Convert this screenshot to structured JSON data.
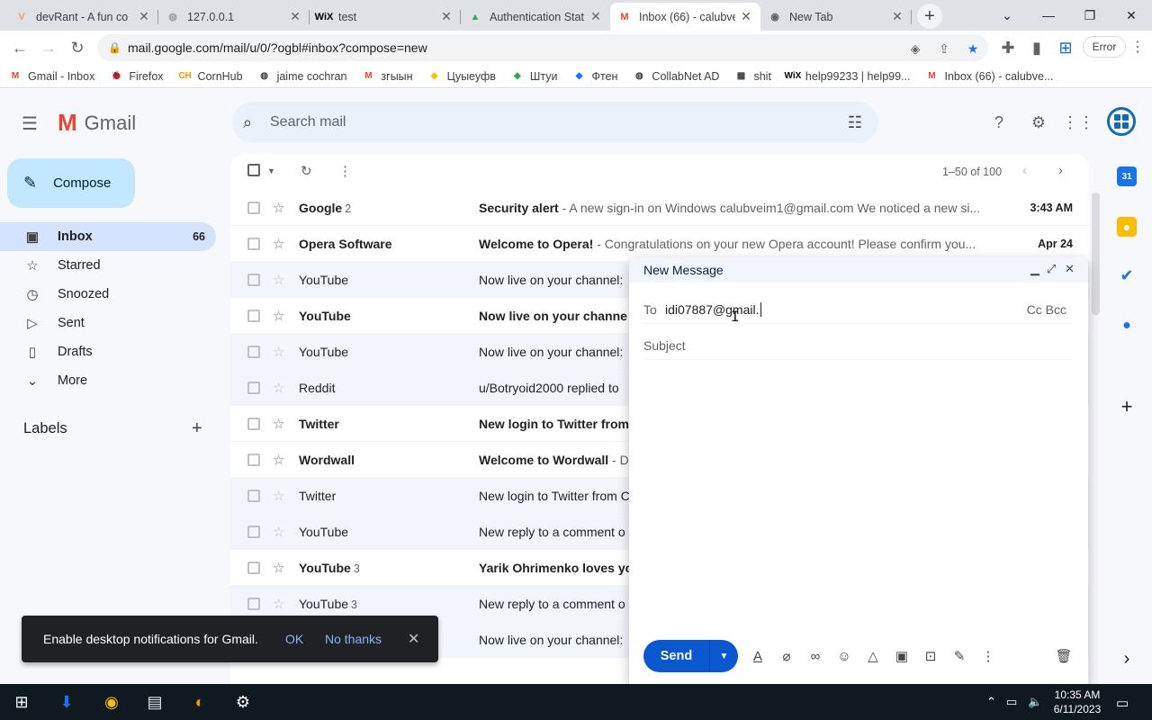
{
  "browser": {
    "tabs": [
      {
        "title": "devRant - A fun co",
        "favicon": "devrant-icon",
        "fav_text": "V",
        "fav_color": "#f99a66"
      },
      {
        "title": "127.0.0.1",
        "favicon": "globe-icon",
        "fav_text": "◍",
        "fav_color": "#9aa0a6"
      },
      {
        "title": "test",
        "favicon": "wix-icon",
        "fav_text": "WiX",
        "fav_color": "#000000"
      },
      {
        "title": "Authentication Stat",
        "favicon": "google-drive-icon",
        "fav_text": "▲",
        "fav_color": "#34a853"
      },
      {
        "title": "Inbox (66) - calubve",
        "favicon": "gmail-icon",
        "fav_text": "M",
        "fav_color": "#ea4335"
      },
      {
        "title": "New Tab",
        "favicon": "chrome-icon",
        "fav_text": "◉",
        "fav_color": "#5f6368"
      }
    ],
    "url": "mail.google.com/mail/u/0/?ogbl#inbox?compose=new",
    "error_label": "Error",
    "bookmarks": [
      {
        "label": "Gmail - Inbox",
        "icon": "gmail-icon",
        "glyph": "M",
        "color": "#ea4335"
      },
      {
        "label": "Firefox",
        "icon": "firefox-icon",
        "glyph": "🐞",
        "color": "#b3261e"
      },
      {
        "label": "CornHub",
        "icon": "cornhub-icon",
        "glyph": "CH",
        "color": "#f29900"
      },
      {
        "label": "jaime cochran",
        "icon": "globe-icon",
        "glyph": "◍",
        "color": "#3c4043"
      },
      {
        "label": "згыын",
        "icon": "gmail-icon",
        "glyph": "M",
        "color": "#ea4335"
      },
      {
        "label": "Цуыеуфв",
        "icon": "maps-pin-icon",
        "glyph": "◆",
        "color": "#fbbc04"
      },
      {
        "label": "Штуи",
        "icon": "maps-pin-icon",
        "glyph": "◆",
        "color": "#34a853"
      },
      {
        "label": "Фтен",
        "icon": "flutter-icon",
        "glyph": "◆",
        "color": "#1a73e8"
      },
      {
        "label": "CollabNet AD",
        "icon": "globe-icon",
        "glyph": "◍",
        "color": "#3c4043"
      },
      {
        "label": "shit",
        "icon": "archive-icon",
        "glyph": "▦",
        "color": "#3c4043"
      },
      {
        "label": "help99233 | help99...",
        "icon": "wix-icon",
        "glyph": "WiX",
        "color": "#000000"
      },
      {
        "label": "Inbox (66) - calubve...",
        "icon": "gmail-icon",
        "glyph": "M",
        "color": "#ea4335"
      }
    ]
  },
  "gmail": {
    "brand": "Gmail",
    "search_placeholder": "Search mail",
    "compose_label": "Compose",
    "nav": [
      {
        "label": "Inbox",
        "count": "66",
        "icon": "inbox-icon",
        "glyph": "▣"
      },
      {
        "label": "Starred",
        "count": "",
        "icon": "star-icon",
        "glyph": "☆"
      },
      {
        "label": "Snoozed",
        "count": "",
        "icon": "clock-icon",
        "glyph": "◷"
      },
      {
        "label": "Sent",
        "count": "",
        "icon": "send-icon",
        "glyph": "▷"
      },
      {
        "label": "Drafts",
        "count": "",
        "icon": "draft-icon",
        "glyph": "▯"
      },
      {
        "label": "More",
        "count": "",
        "icon": "chevron-down-icon",
        "glyph": "⌄"
      }
    ],
    "labels_heading": "Labels",
    "pagination": "1–50 of 100",
    "emails": [
      {
        "sender": "Google",
        "count": "2",
        "subject": "Security alert",
        "snippet": " - A new sign-in on Windows calubveim1@gmail.com We noticed a new si...",
        "date": "3:43 AM",
        "unread": true
      },
      {
        "sender": "Opera Software",
        "count": "",
        "subject": "Welcome to Opera!",
        "snippet": " - Congratulations on your new Opera account! Please confirm you...",
        "date": "Apr 24",
        "unread": true
      },
      {
        "sender": "YouTube",
        "count": "",
        "subject": "Now live on your channel: ",
        "snippet": "",
        "date": "",
        "unread": false
      },
      {
        "sender": "YouTube",
        "count": "",
        "subject": "Now live on your channe",
        "snippet": "",
        "date": "",
        "unread": true
      },
      {
        "sender": "YouTube",
        "count": "",
        "subject": "Now live on your channel: ",
        "snippet": "",
        "date": "",
        "unread": false
      },
      {
        "sender": "Reddit",
        "count": "",
        "subject": "u/Botryoid2000 replied to",
        "snippet": "",
        "date": "",
        "unread": false
      },
      {
        "sender": "Twitter",
        "count": "",
        "subject": "New login to Twitter from",
        "snippet": "",
        "date": "",
        "unread": true
      },
      {
        "sender": "Wordwall",
        "count": "",
        "subject": "Welcome to Wordwall",
        "snippet": " - D",
        "date": "",
        "unread": true
      },
      {
        "sender": "Twitter",
        "count": "",
        "subject": "New login to Twitter from C",
        "snippet": "",
        "date": "",
        "unread": false
      },
      {
        "sender": "YouTube",
        "count": "",
        "subject": "New reply to a comment o",
        "snippet": "",
        "date": "",
        "unread": false
      },
      {
        "sender": "YouTube",
        "count": "3",
        "subject": "Yarik Ohrimenko loves yo",
        "snippet": "",
        "date": "",
        "unread": true
      },
      {
        "sender": "YouTube",
        "count": "3",
        "subject": "New reply to a comment o",
        "snippet": "",
        "date": "",
        "unread": false
      },
      {
        "sender": "",
        "count": "",
        "subject": "Now live on your channel: ",
        "snippet": "",
        "date": "",
        "unread": false
      }
    ]
  },
  "compose": {
    "title": "New Message",
    "to_label": "To",
    "to_value": "idi07887@gmail.",
    "cc_bcc": "Cc Bcc",
    "subject_placeholder": "Subject",
    "send_label": "Send"
  },
  "snackbar": {
    "message": "Enable desktop notifications for Gmail.",
    "ok": "OK",
    "no_thanks": "No thanks"
  },
  "taskbar": {
    "time": "10:35 AM",
    "date": "6/11/2023"
  },
  "colors": {
    "accent": "#0b57d0",
    "compose_bg": "#c2e7ff",
    "active_nav": "#d3e3fd"
  }
}
